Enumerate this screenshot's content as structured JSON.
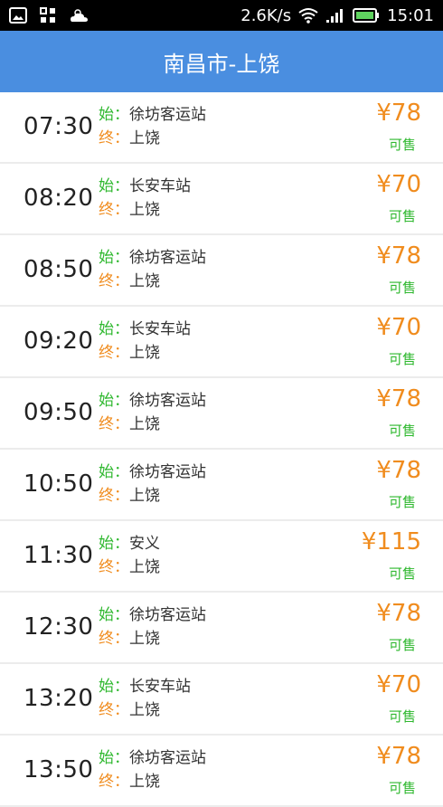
{
  "status_bar": {
    "net_speed": "2.6K/s",
    "time": "15:01",
    "icons": [
      "image-icon",
      "apps-icon",
      "weather-icon",
      "wifi-icon",
      "signal-icon",
      "battery-icon"
    ]
  },
  "header": {
    "title": "南昌市-上饶"
  },
  "labels": {
    "start": "始：",
    "end": "终："
  },
  "colors": {
    "header_bg": "#4a8ee0",
    "start_label": "#2fb82f",
    "end_label": "#f08c1e",
    "price": "#f08c1e",
    "status": "#2fb82f"
  },
  "trips": [
    {
      "time": "07:30",
      "start": "徐坊客运站",
      "end": "上饶",
      "price": "¥78",
      "status": "可售"
    },
    {
      "time": "08:20",
      "start": "长安车站",
      "end": "上饶",
      "price": "¥70",
      "status": "可售"
    },
    {
      "time": "08:50",
      "start": "徐坊客运站",
      "end": "上饶",
      "price": "¥78",
      "status": "可售"
    },
    {
      "time": "09:20",
      "start": "长安车站",
      "end": "上饶",
      "price": "¥70",
      "status": "可售"
    },
    {
      "time": "09:50",
      "start": "徐坊客运站",
      "end": "上饶",
      "price": "¥78",
      "status": "可售"
    },
    {
      "time": "10:50",
      "start": "徐坊客运站",
      "end": "上饶",
      "price": "¥78",
      "status": "可售"
    },
    {
      "time": "11:30",
      "start": "安义",
      "end": "上饶",
      "price": "¥115",
      "status": "可售"
    },
    {
      "time": "12:30",
      "start": "徐坊客运站",
      "end": "上饶",
      "price": "¥78",
      "status": "可售"
    },
    {
      "time": "13:20",
      "start": "长安车站",
      "end": "上饶",
      "price": "¥70",
      "status": "可售"
    },
    {
      "time": "13:50",
      "start": "徐坊客运站",
      "end": "上饶",
      "price": "¥78",
      "status": "可售"
    }
  ]
}
